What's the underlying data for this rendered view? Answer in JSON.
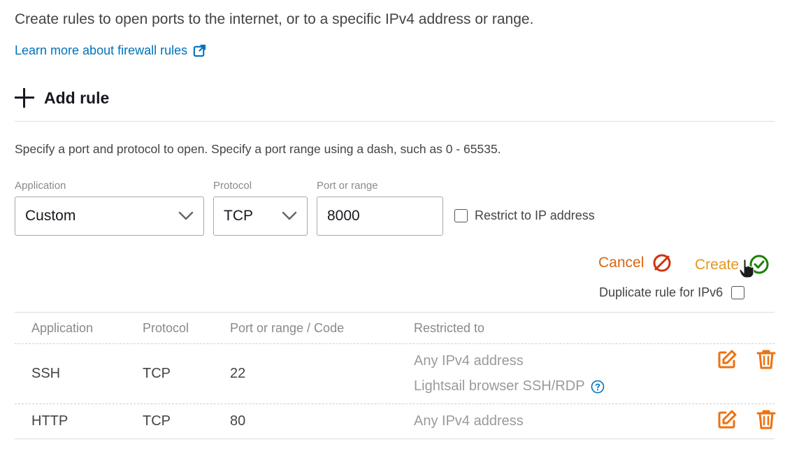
{
  "intro": {
    "text": "Create rules to open ports to the internet, or to a specific IPv4 address or range.",
    "learn_more": "Learn more about firewall rules",
    "learn_more_icon": "external-link-icon"
  },
  "add_rule": {
    "label": "Add rule",
    "icon": "plus-icon"
  },
  "form": {
    "hint": "Specify a port and protocol to open. Specify a port range using a dash, such as 0 - 65535.",
    "application": {
      "label": "Application",
      "value": "Custom"
    },
    "protocol": {
      "label": "Protocol",
      "value": "TCP"
    },
    "port": {
      "label": "Port or range",
      "value": "8000"
    },
    "restrict_label": "Restrict to IP address",
    "cancel_label": "Cancel",
    "create_label": "Create",
    "duplicate_label": "Duplicate rule for IPv6"
  },
  "table": {
    "headers": [
      "Application",
      "Protocol",
      "Port or range / Code",
      "Restricted to"
    ],
    "rows": [
      {
        "application": "SSH",
        "protocol": "TCP",
        "port": "22",
        "restricted": "Any IPv4 address",
        "restricted_extra": "Lightsail browser SSH/RDP"
      },
      {
        "application": "HTTP",
        "protocol": "TCP",
        "port": "80",
        "restricted": "Any IPv4 address"
      }
    ]
  },
  "colors": {
    "link": "#0073bb",
    "cancel": "#d86613",
    "cancel_icon": "#d13212",
    "create": "#e4961e",
    "create_icon": "#1d8102",
    "action_icon": "#ec7211"
  }
}
